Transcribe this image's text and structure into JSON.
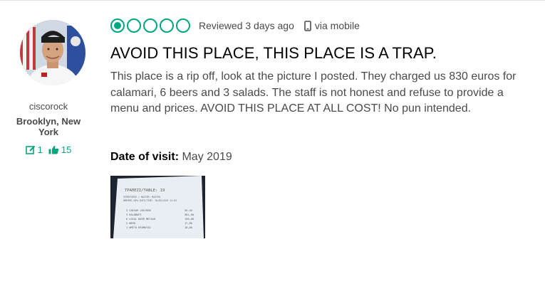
{
  "reviewer": {
    "username": "ciscorock",
    "location": "Brooklyn, New York",
    "contributions": "1",
    "helpful_votes": "15"
  },
  "review": {
    "rating": 1,
    "rating_max": 5,
    "review_date": "Reviewed 3 days ago",
    "via": "via mobile",
    "title": "AVOID THIS PLACE, THIS PLACE IS A TRAP.",
    "text": "This place is a rip off, look at the picture I posted. They charged us 830 euros for calamari, 6 beers and 3 salads. The staff is not honest and refuse to provide a menu and prices. AVOID THIS PLACE AT ALL COST! No pun intended.",
    "visit_label": "Date of visit:",
    "visit_date": "May 2019"
  },
  "colors": {
    "accent": "#00a680",
    "title": "#000000",
    "text": "#4a4a4a"
  },
  "icons": {
    "contributions": "review-pencil-icon",
    "helpful": "thumbs-up-icon",
    "device": "mobile-phone-icon"
  },
  "receipt": {
    "header": "ΤΡΑΠΕΖΙ/TABLE: 19",
    "lines": [
      "ΣΕΡΒΙΤΟΡΟΣ / WAITER: MASTER",
      "ΗΜΕΡΟΜ./ΩΡΑ-DATE/TIME: 18/05/2019 14:03"
    ],
    "items": [
      {
        "label": "3 CAESAR CHICKEN",
        "price": "59,40"
      },
      {
        "label": "3 KALAMAPI",
        "price": "581,00"
      },
      {
        "label": "6 LOCAL BEER MEΓAΛH",
        "price": "150,00"
      },
      {
        "label": "2 NEPO",
        "price": "17,80"
      },
      {
        "label": "1 AMITA NTOMATAΣ",
        "price": "18,00"
      }
    ]
  }
}
